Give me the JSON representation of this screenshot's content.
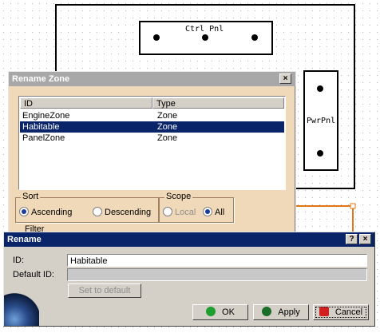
{
  "canvas": {
    "ctrl_panel_label": "Ctrl Pnl",
    "pwr_panel_label": "PwrPnl"
  },
  "rename_zone": {
    "title": "Rename Zone",
    "close_glyph": "×",
    "columns": [
      "ID",
      "Type"
    ],
    "rows": [
      {
        "id": "EngineZone",
        "type": "Zone",
        "selected": false
      },
      {
        "id": "Habitable",
        "type": "Zone",
        "selected": true
      },
      {
        "id": "PanelZone",
        "type": "Zone",
        "selected": false
      }
    ],
    "sort": {
      "label": "Sort",
      "ascending": "Ascending",
      "descending": "Descending",
      "selected": "Ascending"
    },
    "scope": {
      "label": "Scope",
      "local": "Local",
      "all": "All",
      "selected": "All"
    },
    "filter_label": "Filter"
  },
  "rename": {
    "title": "Rename",
    "help_glyph": "?",
    "close_glyph": "×",
    "id_label": "ID:",
    "id_value": "Habitable",
    "default_id_label": "Default ID:",
    "default_id_value": "",
    "set_default_label": "Set to default",
    "ok_label": "OK",
    "apply_label": "Apply",
    "cancel_label": "Cancel",
    "colors": {
      "ok": "#1e9e2e",
      "apply": "#1b6e2a",
      "cancel": "#d02020"
    }
  }
}
